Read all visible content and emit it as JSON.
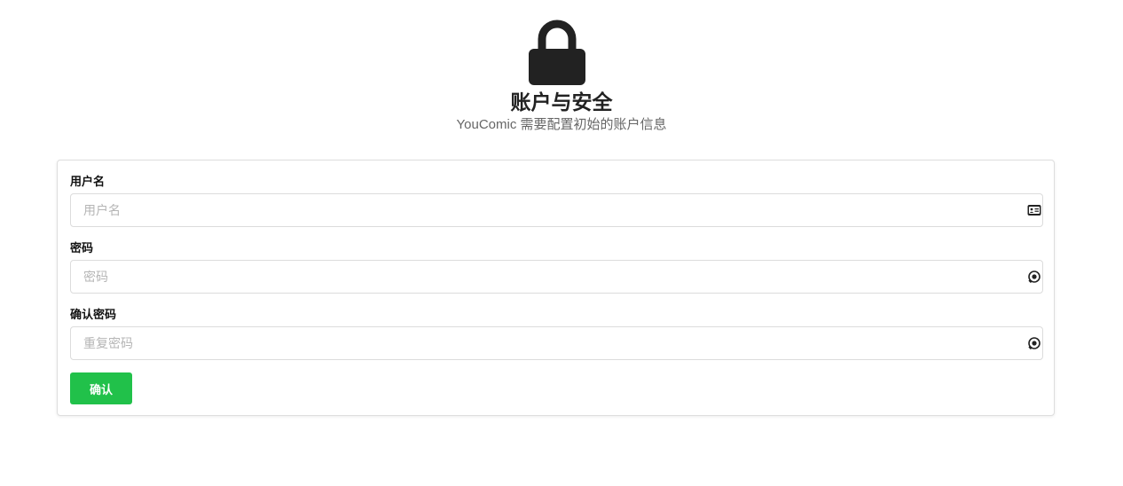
{
  "header": {
    "icon": "lock-icon",
    "title": "账户与安全",
    "subtitle": "YouComic 需要配置初始的账户信息"
  },
  "form": {
    "username": {
      "label": "用户名",
      "placeholder": "用户名",
      "value": "",
      "icon": "id-card-icon"
    },
    "password": {
      "label": "密码",
      "placeholder": "密码",
      "value": "",
      "icon": "password-eye-icon"
    },
    "confirm_password": {
      "label": "确认密码",
      "placeholder": "重复密码",
      "value": "",
      "icon": "password-eye-icon"
    },
    "submit_label": "确认"
  },
  "colors": {
    "accent": "#21c14a",
    "icon": "#222222",
    "subtitle": "#666666",
    "border": "#dcdcdc"
  }
}
